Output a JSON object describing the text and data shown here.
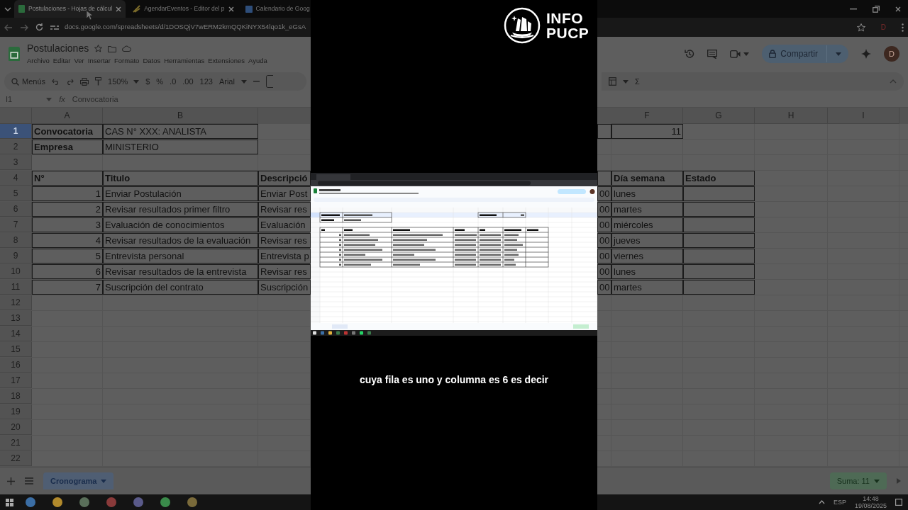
{
  "logo": {
    "line1": "INFO",
    "line2": "PUCP"
  },
  "background_left": {
    "tabs": [
      {
        "label": "Postulaciones - Hojas de cálcul",
        "selected": true
      },
      {
        "label": "AgendarEventos - Editor del p",
        "selected": false
      },
      {
        "label": "Calendario de Goog",
        "selected": false
      }
    ],
    "url": "docs.google.com/spreadsheets/d/1DOSQjV7wERM2kmQQKiNYX54lqo1k_eGsA",
    "doc_title": "Postulaciones",
    "menu": [
      "Archivo",
      "Editar",
      "Ver",
      "Insertar",
      "Formato",
      "Datos",
      "Herramientas",
      "Extensiones",
      "Ayuda"
    ],
    "toolbar": {
      "search": "Menús",
      "zoom": "150%",
      "items": [
        "$",
        "%",
        ".0",
        ".00",
        "123"
      ],
      "font": "Arial"
    },
    "name_box": "I1",
    "fx": "fx",
    "formula": "Convocatoria",
    "columns": [
      "A",
      "B"
    ],
    "rows": [
      {
        "number": "1",
        "selected": true,
        "cells": {
          "A": {
            "text": "Convocatoria",
            "bold": true,
            "bordered": true
          },
          "B": {
            "text": "CAS N° XXX: ANALISTA",
            "bordered": true
          }
        }
      },
      {
        "number": "2",
        "selected": false,
        "cells": {
          "A": {
            "text": "Empresa",
            "bold": true,
            "bordered": true
          },
          "B": {
            "text": "MINISTERIO",
            "bordered": true
          }
        }
      },
      {
        "number": "3",
        "selected": false
      },
      {
        "number": "4",
        "selected": false,
        "cells": {
          "A": {
            "text": "N°",
            "bold": true,
            "bordered": true
          },
          "B": {
            "text": "Titulo",
            "bold": true,
            "bordered": true
          },
          "partial": {
            "text": "Descripció",
            "bold": true,
            "bordered": true
          }
        }
      },
      {
        "number": "5",
        "selected": false,
        "cells": {
          "A": {
            "text": "1",
            "right_aligned": true,
            "bordered": true
          },
          "B": {
            "text": "Enviar Postulación",
            "bordered": true
          },
          "partial": {
            "text": "Enviar Post",
            "bordered": true
          }
        }
      },
      {
        "number": "6",
        "selected": false,
        "cells": {
          "A": {
            "text": "2",
            "right_aligned": true,
            "bordered": true
          },
          "B": {
            "text": "Revisar resultados primer filtro",
            "bordered": true
          },
          "partial": {
            "text": "Revisar res",
            "bordered": true
          }
        }
      },
      {
        "number": "7",
        "selected": false,
        "cells": {
          "A": {
            "text": "3",
            "right_aligned": true,
            "bordered": true
          },
          "B": {
            "text": "Evaluación de conocimientos",
            "bordered": true
          },
          "partial": {
            "text": "Evaluación",
            "bordered": true
          }
        }
      },
      {
        "number": "8",
        "selected": false,
        "cells": {
          "A": {
            "text": "4",
            "right_aligned": true,
            "bordered": true
          },
          "B": {
            "text": "Revisar resultados de la evaluación",
            "bordered": true
          },
          "partial": {
            "text": "Revisar res",
            "bordered": true
          }
        }
      },
      {
        "number": "9",
        "selected": false,
        "cells": {
          "A": {
            "text": "5",
            "right_aligned": true,
            "bordered": true
          },
          "B": {
            "text": "Entrevista personal",
            "bordered": true
          },
          "partial": {
            "text": "Entrevista p",
            "bordered": true
          }
        }
      },
      {
        "number": "10",
        "selected": false,
        "cells": {
          "A": {
            "text": "6",
            "right_aligned": true,
            "bordered": true
          },
          "B": {
            "text": "Revisar resultados de la entrevista",
            "bordered": true
          },
          "partial": {
            "text": "Revisar res",
            "bordered": true
          }
        }
      },
      {
        "number": "11",
        "selected": false,
        "cells": {
          "A": {
            "text": "7",
            "right_aligned": true,
            "bordered": true
          },
          "B": {
            "text": "Suscripción del contrato",
            "bordered": true
          },
          "partial": {
            "text": "Suscripción",
            "bordered": true
          }
        }
      },
      {
        "number": "12",
        "selected": false
      },
      {
        "number": "13",
        "selected": false
      },
      {
        "number": "14",
        "selected": false
      },
      {
        "number": "15",
        "selected": false
      },
      {
        "number": "16",
        "selected": false
      },
      {
        "number": "17",
        "selected": false
      },
      {
        "number": "18",
        "selected": false
      },
      {
        "number": "19",
        "selected": false
      },
      {
        "number": "20",
        "selected": false
      },
      {
        "number": "21",
        "selected": false
      },
      {
        "number": "22",
        "selected": false
      }
    ],
    "sheet_tab": "Cronograma"
  },
  "background_right": {
    "extension_badge": "D",
    "share": "Compartir",
    "avatar": "D",
    "sigma": "Σ",
    "columns": [
      "F",
      "G",
      "H",
      "I"
    ],
    "rows": [
      {
        "cells": {
          "partial": {
            "bordered": true
          },
          "F": {
            "text": "11",
            "right_aligned": true,
            "bordered": true
          }
        }
      },
      {
        "cells": {}
      },
      {
        "cells": {}
      },
      {
        "cells": {
          "partial": {
            "bordered": true
          },
          "F": {
            "text": "Día semana",
            "bold": true,
            "bordered": true
          },
          "G": {
            "text": "Estado",
            "bold": true,
            "bordered": true
          }
        }
      },
      {
        "cells": {
          "partial": {
            "text": "00",
            "bordered": true
          },
          "F": {
            "text": "lunes",
            "bordered": true
          },
          "G": {
            "bordered": true
          }
        }
      },
      {
        "cells": {
          "partial": {
            "text": "00",
            "bordered": true
          },
          "F": {
            "text": "martes",
            "bordered": true
          },
          "G": {
            "bordered": true
          }
        }
      },
      {
        "cells": {
          "partial": {
            "text": "00",
            "bordered": true
          },
          "F": {
            "text": "miércoles",
            "bordered": true
          },
          "G": {
            "bordered": true
          }
        }
      },
      {
        "cells": {
          "partial": {
            "text": "00",
            "bordered": true
          },
          "F": {
            "text": "jueves",
            "bordered": true
          },
          "G": {
            "bordered": true
          }
        }
      },
      {
        "cells": {
          "partial": {
            "text": "00",
            "bordered": true
          },
          "F": {
            "text": "viernes",
            "bordered": true
          },
          "G": {
            "bordered": true
          }
        }
      },
      {
        "cells": {
          "partial": {
            "text": "00",
            "bordered": true
          },
          "F": {
            "text": "lunes",
            "bordered": true
          },
          "G": {
            "bordered": true
          }
        }
      },
      {
        "cells": {
          "partial": {
            "text": "00",
            "bordered": true
          },
          "F": {
            "text": "martes",
            "bordered": true
          },
          "G": {
            "bordered": true
          }
        }
      }
    ],
    "sum": "Suma: 11",
    "language": "ESP",
    "time": "14:48",
    "date": "19/08/2025"
  },
  "caption": "cuya fila es uno y columna es 6 es decir"
}
